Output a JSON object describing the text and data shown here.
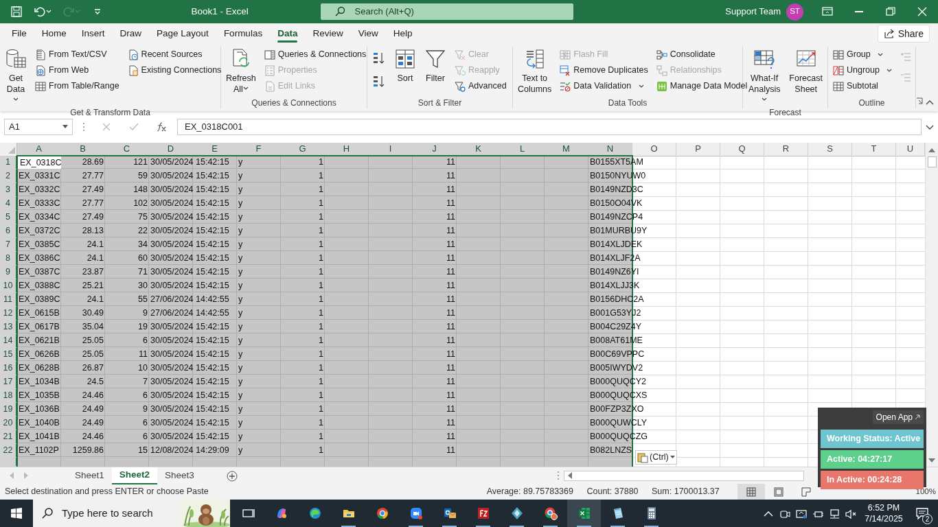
{
  "window": {
    "quick_access": [
      {
        "kind": "save",
        "disabled": false
      },
      {
        "kind": "undo",
        "disabled": false
      },
      {
        "kind": "redo",
        "disabled": true
      },
      {
        "kind": "customize",
        "disabled": false
      }
    ],
    "title": "Book1 - Excel",
    "search": {
      "placeholder": "Search (Alt+Q)"
    },
    "account": {
      "name": "Support Team",
      "initials": "ST"
    }
  },
  "tabs": [
    {
      "label": "File",
      "selected": false
    },
    {
      "label": "Home",
      "selected": false
    },
    {
      "label": "Insert",
      "selected": false
    },
    {
      "label": "Draw",
      "selected": false
    },
    {
      "label": "Page Layout",
      "selected": false
    },
    {
      "label": "Formulas",
      "selected": false
    },
    {
      "label": "Data",
      "selected": true
    },
    {
      "label": "Review",
      "selected": false
    },
    {
      "label": "View",
      "selected": false
    },
    {
      "label": "Help",
      "selected": false
    }
  ],
  "share": "Share",
  "ribbon": {
    "groups": [
      {
        "label": "Get & Transform Data",
        "columns": [
          [
            {
              "kind": "large",
              "label": "Get Data",
              "dropdown": true,
              "disabled": false
            }
          ],
          [
            {
              "kind": "small",
              "label": "From Text/CSV",
              "disabled": false
            },
            {
              "kind": "small",
              "label": "From Web",
              "disabled": false
            },
            {
              "kind": "small",
              "label": "From Table/Range",
              "disabled": false
            }
          ],
          [
            {
              "kind": "small",
              "label": "Recent Sources",
              "disabled": false
            },
            {
              "kind": "small",
              "label": "Existing Connections",
              "disabled": false
            }
          ]
        ]
      },
      {
        "label": "Queries & Connections",
        "columns": [
          [
            {
              "kind": "large",
              "label": "Refresh All",
              "dropdown": true,
              "disabled": false
            }
          ],
          [
            {
              "kind": "small",
              "label": "Queries & Connections",
              "disabled": false
            },
            {
              "kind": "small",
              "label": "Properties",
              "disabled": true
            },
            {
              "kind": "small",
              "label": "Edit Links",
              "disabled": true
            }
          ]
        ]
      },
      {
        "label": "Sort & Filter",
        "columns": [
          [
            {
              "kind": "icon",
              "disabled": false
            },
            {
              "kind": "icon",
              "disabled": false
            }
          ],
          [
            {
              "kind": "large",
              "label": "Sort",
              "disabled": false
            }
          ],
          [
            {
              "kind": "large",
              "label": "Filter",
              "disabled": false
            }
          ],
          [
            {
              "kind": "small",
              "label": "Clear",
              "disabled": true
            },
            {
              "kind": "small",
              "label": "Reapply",
              "disabled": true
            },
            {
              "kind": "small",
              "label": "Advanced",
              "disabled": false
            }
          ]
        ]
      },
      {
        "label": "Data Tools",
        "columns": [
          [
            {
              "kind": "large",
              "label": "Text to Columns",
              "disabled": false
            }
          ],
          [
            {
              "kind": "small",
              "label": "Flash Fill",
              "disabled": true
            },
            {
              "kind": "small",
              "label": "Remove Duplicates",
              "disabled": false
            },
            {
              "kind": "small",
              "label": "Data Validation",
              "dropdown": true,
              "disabled": false
            }
          ],
          [
            {
              "kind": "small",
              "label": "Consolidate",
              "disabled": false
            },
            {
              "kind": "small",
              "label": "Relationships",
              "disabled": true
            },
            {
              "kind": "small",
              "label": "Manage Data Model",
              "disabled": false
            }
          ]
        ]
      },
      {
        "label": "Forecast",
        "columns": [
          [
            {
              "kind": "large",
              "label": "What-If Analysis",
              "dropdown": true,
              "disabled": false
            }
          ],
          [
            {
              "kind": "large",
              "label": "Forecast Sheet",
              "disabled": false
            }
          ]
        ]
      },
      {
        "label": "Outline",
        "columns": [
          [
            {
              "kind": "small",
              "label": "Group",
              "dropdown": true,
              "disabled": false
            },
            {
              "kind": "small",
              "label": "Ungroup",
              "dropdown": true,
              "disabled": false
            },
            {
              "kind": "small",
              "label": "Subtotal",
              "disabled": false
            }
          ],
          [
            {
              "kind": "icon",
              "disabled": true
            },
            {
              "kind": "icon",
              "disabled": true
            }
          ]
        ]
      }
    ]
  },
  "formula_bar": {
    "name_box": "A1",
    "formula": "EX_0318C001"
  },
  "sheet": {
    "columns": [
      {
        "label": "A",
        "selected": true
      },
      {
        "label": "B",
        "selected": true
      },
      {
        "label": "C",
        "selected": true
      },
      {
        "label": "D",
        "selected": true
      },
      {
        "label": "E",
        "selected": true
      },
      {
        "label": "F",
        "selected": true
      },
      {
        "label": "G",
        "selected": true
      },
      {
        "label": "H",
        "selected": true
      },
      {
        "label": "I",
        "selected": true
      },
      {
        "label": "J",
        "selected": true
      },
      {
        "label": "K",
        "selected": true
      },
      {
        "label": "L",
        "selected": true
      },
      {
        "label": "M",
        "selected": true
      },
      {
        "label": "N",
        "selected": true
      },
      {
        "label": "O",
        "selected": false
      },
      {
        "label": "P",
        "selected": false
      },
      {
        "label": "Q",
        "selected": false
      },
      {
        "label": "R",
        "selected": false
      },
      {
        "label": "S",
        "selected": false
      },
      {
        "label": "T",
        "selected": false
      },
      {
        "label": "U",
        "selected": false
      }
    ],
    "rows": [
      {
        "number": "1",
        "selected": true,
        "column_a": "EX_0318C",
        "column_b": "28.69",
        "column_c": "121",
        "column_d": "30/05/2024 15:42:15",
        "column_f": "y",
        "column_g": "1",
        "column_j": "11",
        "column_n": "B0155XT5AM"
      },
      {
        "number": "2",
        "selected": true,
        "column_a": "EX_0331C",
        "column_b": "27.77",
        "column_c": "59",
        "column_d": "30/05/2024 15:42:15",
        "column_f": "y",
        "column_g": "1",
        "column_j": "11",
        "column_n": "B0150NYUW0"
      },
      {
        "number": "3",
        "selected": true,
        "column_a": "EX_0332C",
        "column_b": "27.49",
        "column_c": "148",
        "column_d": "30/05/2024 15:42:15",
        "column_f": "y",
        "column_g": "1",
        "column_j": "11",
        "column_n": "B0149NZD3C"
      },
      {
        "number": "4",
        "selected": true,
        "column_a": "EX_0333C",
        "column_b": "27.77",
        "column_c": "102",
        "column_d": "30/05/2024 15:42:15",
        "column_f": "y",
        "column_g": "1",
        "column_j": "11",
        "column_n": "B0150O04VK"
      },
      {
        "number": "5",
        "selected": true,
        "column_a": "EX_0334C",
        "column_b": "27.49",
        "column_c": "75",
        "column_d": "30/05/2024 15:42:15",
        "column_f": "y",
        "column_g": "1",
        "column_j": "11",
        "column_n": "B0149NZCP4"
      },
      {
        "number": "6",
        "selected": true,
        "column_a": "EX_0372C",
        "column_b": "28.13",
        "column_c": "22",
        "column_d": "30/05/2024 15:42:15",
        "column_f": "y",
        "column_g": "1",
        "column_j": "11",
        "column_n": "B01MURBU9Y"
      },
      {
        "number": "7",
        "selected": true,
        "column_a": "EX_0385C",
        "column_b": "24.1",
        "column_c": "34",
        "column_d": "30/05/2024 15:42:15",
        "column_f": "y",
        "column_g": "1",
        "column_j": "11",
        "column_n": "B014XLJDEK"
      },
      {
        "number": "8",
        "selected": true,
        "column_a": "EX_0386C",
        "column_b": "24.1",
        "column_c": "60",
        "column_d": "30/05/2024 15:42:15",
        "column_f": "y",
        "column_g": "1",
        "column_j": "11",
        "column_n": "B014XLJF2A"
      },
      {
        "number": "9",
        "selected": true,
        "column_a": "EX_0387C",
        "column_b": "23.87",
        "column_c": "71",
        "column_d": "30/05/2024 15:42:15",
        "column_f": "y",
        "column_g": "1",
        "column_j": "11",
        "column_n": "B0149NZ6YI"
      },
      {
        "number": "10",
        "selected": true,
        "column_a": "EX_0388C",
        "column_b": "25.21",
        "column_c": "30",
        "column_d": "30/05/2024 15:42:15",
        "column_f": "y",
        "column_g": "1",
        "column_j": "11",
        "column_n": "B014XLJJ3K"
      },
      {
        "number": "11",
        "selected": true,
        "column_a": "EX_0389C",
        "column_b": "24.1",
        "column_c": "55",
        "column_d": "27/06/2024 14:42:55",
        "column_f": "y",
        "column_g": "1",
        "column_j": "11",
        "column_n": "B0156DHC2A"
      },
      {
        "number": "12",
        "selected": true,
        "column_a": "EX_0615B",
        "column_b": "30.49",
        "column_c": "9",
        "column_d": "27/06/2024 14:42:55",
        "column_f": "y",
        "column_g": "1",
        "column_j": "11",
        "column_n": "B001G53YJ2"
      },
      {
        "number": "13",
        "selected": true,
        "column_a": "EX_0617B",
        "column_b": "35.04",
        "column_c": "19",
        "column_d": "30/05/2024 15:42:15",
        "column_f": "y",
        "column_g": "1",
        "column_j": "11",
        "column_n": "B004C29Z4Y"
      },
      {
        "number": "14",
        "selected": true,
        "column_a": "EX_0621B",
        "column_b": "25.05",
        "column_c": "6",
        "column_d": "30/05/2024 15:42:15",
        "column_f": "y",
        "column_g": "1",
        "column_j": "11",
        "column_n": "B008AT61ME"
      },
      {
        "number": "15",
        "selected": true,
        "column_a": "EX_0626B",
        "column_b": "25.05",
        "column_c": "11",
        "column_d": "30/05/2024 15:42:15",
        "column_f": "y",
        "column_g": "1",
        "column_j": "11",
        "column_n": "B00C69VPPC"
      },
      {
        "number": "16",
        "selected": true,
        "column_a": "EX_0628B",
        "column_b": "26.87",
        "column_c": "10",
        "column_d": "30/05/2024 15:42:15",
        "column_f": "y",
        "column_g": "1",
        "column_j": "11",
        "column_n": "B005IWYDV2"
      },
      {
        "number": "17",
        "selected": true,
        "column_a": "EX_1034B",
        "column_b": "24.5",
        "column_c": "7",
        "column_d": "30/05/2024 15:42:15",
        "column_f": "y",
        "column_g": "1",
        "column_j": "11",
        "column_n": "B000QUQCY2"
      },
      {
        "number": "18",
        "selected": true,
        "column_a": "EX_1035B",
        "column_b": "24.46",
        "column_c": "6",
        "column_d": "30/05/2024 15:42:15",
        "column_f": "y",
        "column_g": "1",
        "column_j": "11",
        "column_n": "B000QUQCXS"
      },
      {
        "number": "19",
        "selected": true,
        "column_a": "EX_1036B",
        "column_b": "24.49",
        "column_c": "9",
        "column_d": "30/05/2024 15:42:15",
        "column_f": "y",
        "column_g": "1",
        "column_j": "11",
        "column_n": "B00FZP3ZXO"
      },
      {
        "number": "20",
        "selected": true,
        "column_a": "EX_1040B",
        "column_b": "24.49",
        "column_c": "6",
        "column_d": "30/05/2024 15:42:15",
        "column_f": "y",
        "column_g": "1",
        "column_j": "11",
        "column_n": "B000QUWCLY"
      },
      {
        "number": "21",
        "selected": true,
        "column_a": "EX_1041B",
        "column_b": "24.46",
        "column_c": "6",
        "column_d": "30/05/2024 15:42:15",
        "column_f": "y",
        "column_g": "1",
        "column_j": "11",
        "column_n": "B000QUQCZG"
      },
      {
        "number": "22",
        "selected": true,
        "column_a": "EX_1102P",
        "column_b": "1259.86",
        "column_c": "15",
        "column_d": "12/08/2024 14:29:09",
        "column_f": "y",
        "column_g": "1",
        "column_j": "11",
        "column_n": "B082LNZS"
      }
    ]
  },
  "paste_options": {
    "label": "(Ctrl)"
  },
  "sheet_tabs": [
    {
      "label": "Sheet1",
      "selected": false
    },
    {
      "label": "Sheet2",
      "selected": true
    },
    {
      "label": "Sheet3",
      "selected": false
    }
  ],
  "status_bar": {
    "message": "Select destination and press ENTER or choose Paste",
    "average": "Average: 89.75783369",
    "count": "Count: 37880",
    "sum": "Sum: 1700013.37",
    "views": [
      {
        "selected": true
      },
      {
        "selected": false
      },
      {
        "selected": false
      }
    ],
    "zoom": "100%"
  },
  "tracker": {
    "button": "Open App",
    "rows": [
      {
        "label": "Working Status: Active",
        "color": "#6ec5d0"
      },
      {
        "label": "Active: 04:27:17",
        "color": "#5dd08b"
      },
      {
        "label": "In Active: 00:24:28",
        "color": "#e9766b"
      }
    ]
  },
  "taskbar": {
    "search_placeholder": "Type here to search",
    "apps": [
      {
        "running": false,
        "selected": false
      },
      {
        "running": false,
        "selected": false
      },
      {
        "running": false,
        "selected": false
      },
      {
        "running": true,
        "selected": false
      },
      {
        "running": false,
        "selected": false
      },
      {
        "running": true,
        "selected": false
      },
      {
        "running": true,
        "selected": false
      },
      {
        "running": true,
        "selected": false
      },
      {
        "running": true,
        "selected": false
      },
      {
        "running": true,
        "selected": false
      },
      {
        "running": true,
        "selected": true
      },
      {
        "running": true,
        "selected": false
      },
      {
        "running": true,
        "selected": false
      }
    ],
    "time": "6:52 PM",
    "date": "7/14/2025",
    "notifications": "2"
  }
}
